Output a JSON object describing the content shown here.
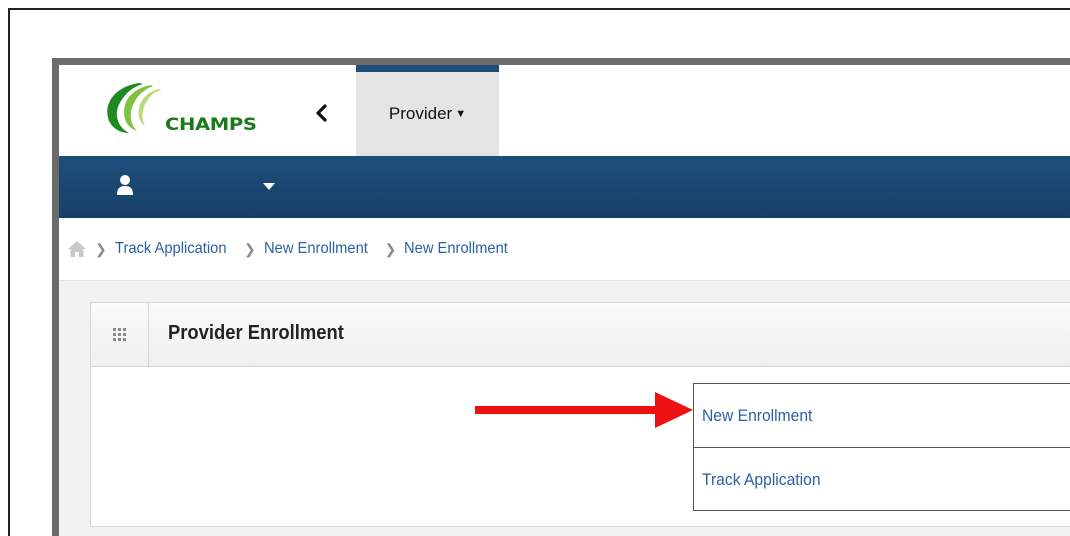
{
  "header": {
    "logo_text": "CHAMPS",
    "provider_menu_label": "Provider"
  },
  "breadcrumb": {
    "items": [
      "Track Application",
      "New Enrollment",
      "New Enrollment"
    ]
  },
  "panel": {
    "title": "Provider Enrollment",
    "menu_items": [
      "New Enrollment",
      "Track Application"
    ]
  },
  "colors": {
    "brand_blue": "#1d4f7c",
    "link_blue": "#2b5fa6",
    "logo_green": "#1a7a1a",
    "annotation_red": "#ee1111"
  },
  "icons": {
    "collapse": "chevron-left-icon",
    "user": "user-icon",
    "user_menu": "caret-down-icon",
    "home": "home-icon",
    "panel_grid": "grid-icon",
    "annotation": "red-arrow"
  }
}
